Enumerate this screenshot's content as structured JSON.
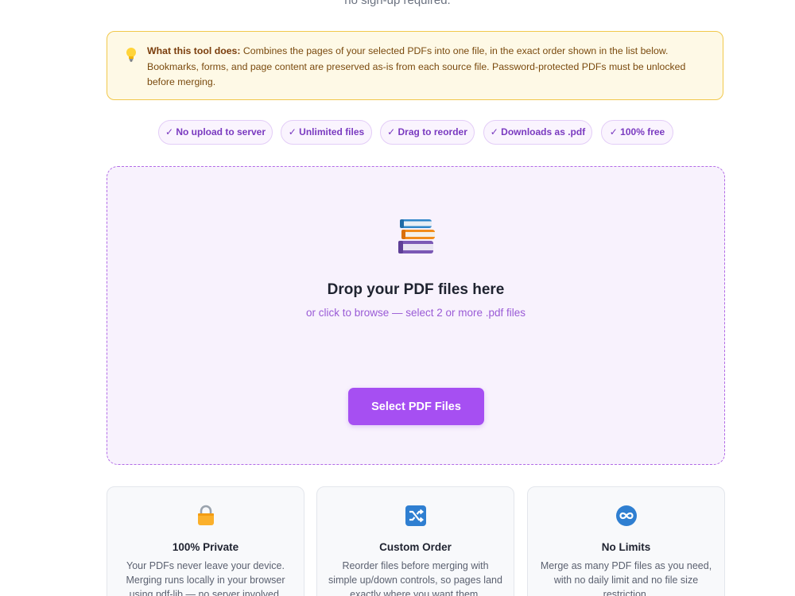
{
  "header": {
    "subtitle_fragment": "no sign-up required."
  },
  "info": {
    "icon": "lightbulb-icon",
    "bold": "What this tool does:",
    "text": " Combines the pages of your selected PDFs into one file, in the exact order shown in the list below. Bookmarks, forms, and page content are preserved as-is from each source file. Password-protected PDFs must be unlocked before merging.",
    "accent_color": "#f1c84b"
  },
  "features": [
    "✓ No upload to server",
    "✓ Unlimited files",
    "✓ Drag to reorder",
    "✓ Downloads as .pdf",
    "✓ 100% free"
  ],
  "dropzone": {
    "icon": "books-icon",
    "title": "Drop your PDF files here",
    "subtitle": "or click to browse — select 2 or more .pdf files",
    "button_label": "Select PDF Files",
    "accent_color": "#a64ff2"
  },
  "cards": [
    {
      "icon": "lock-icon",
      "title": "100% Private",
      "description": "Your PDFs never leave your device. Merging runs locally in your browser using pdf-lib — no server involved."
    },
    {
      "icon": "shuffle-icon",
      "title": "Custom Order",
      "description": "Reorder files before merging with simple up/down controls, so pages land exactly where you want them."
    },
    {
      "icon": "infinity-icon",
      "title": "No Limits",
      "description": "Merge as many PDF files as you need, with no daily limit and no file size restriction."
    }
  ]
}
